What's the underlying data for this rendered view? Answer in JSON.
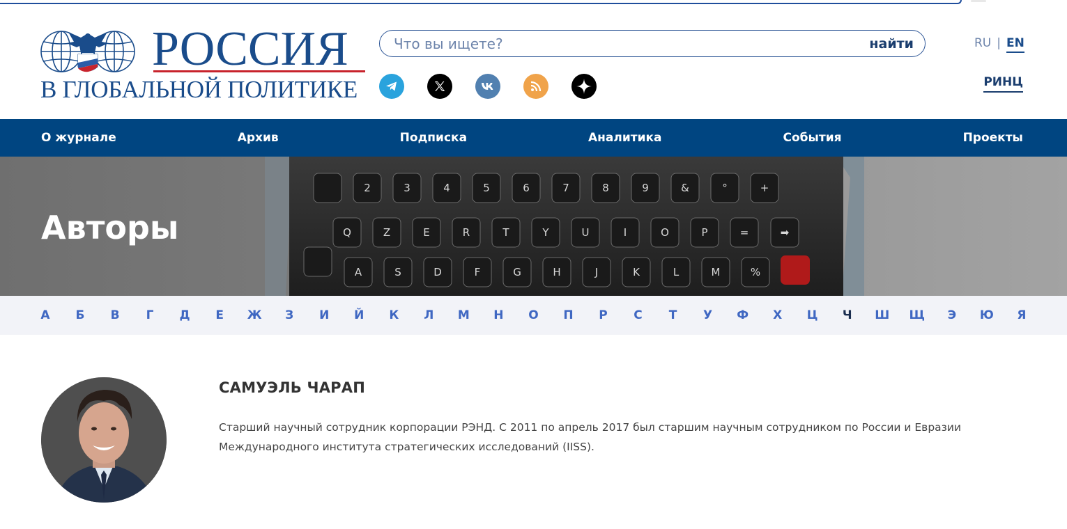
{
  "header": {
    "logo_title": "РОССИЯ",
    "logo_subtitle": "В ГЛОБАЛЬНОЙ ПОЛИТИКЕ",
    "search": {
      "placeholder": "Что вы ищете?",
      "value": "",
      "button_label": "найти"
    },
    "socials": [
      {
        "icon": "telegram-icon",
        "color": "#2aa3dd"
      },
      {
        "icon": "x-icon",
        "color": "#000000"
      },
      {
        "icon": "vk-icon",
        "color": "#5180b0"
      },
      {
        "icon": "rss-icon",
        "color": "#f0a34a"
      },
      {
        "icon": "zen-icon",
        "color": "#000000"
      }
    ],
    "lang": {
      "ru": "RU",
      "separator": "|",
      "en": "EN",
      "active": "EN"
    },
    "rinc_label": "РИНЦ"
  },
  "nav": {
    "items": [
      "О журнале",
      "Архив",
      "Подписка",
      "Аналитика",
      "События",
      "Проекты"
    ]
  },
  "hero": {
    "title": "Авторы"
  },
  "alphabet": {
    "letters": [
      "А",
      "Б",
      "В",
      "Г",
      "Д",
      "Е",
      "Ж",
      "З",
      "И",
      "Й",
      "К",
      "Л",
      "М",
      "Н",
      "О",
      "П",
      "Р",
      "С",
      "Т",
      "У",
      "Ф",
      "Х",
      "Ц",
      "Ч",
      "Ш",
      "Щ",
      "Э",
      "Ю",
      "Я"
    ],
    "current": "Ч"
  },
  "author": {
    "name": "САМУЭЛЬ ЧАРАП",
    "bio": "Старший научный сотрудник корпорации РЭНД. С 2011 по апрель 2017 был старшим научным сотрудником по России и Евразии Международного института стратегических исследований (IISS)."
  },
  "colors": {
    "brand_blue": "#1a4c8b",
    "nav_bg": "#004581",
    "accent_red": "#c8232c",
    "alphabet_bg": "#f2f3f8",
    "alphabet_link": "#3f67c2"
  }
}
